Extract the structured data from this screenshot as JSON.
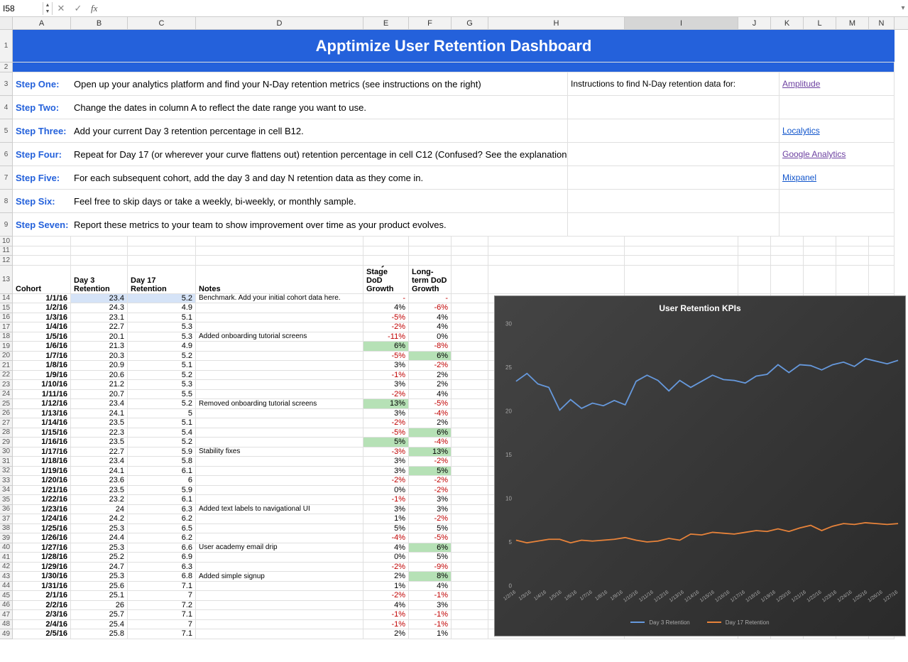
{
  "namebox": "I58",
  "banner": "Apptimize User Retention Dashboard",
  "steps": [
    {
      "label": "Step One:",
      "text": "Open up your analytics platform and find your N-Day retention metrics (see instructions on the right)"
    },
    {
      "label": "Step Two:",
      "text": "Change the dates in column A to reflect the date range you want to use."
    },
    {
      "label": "Step Three:",
      "text": "Add your current Day 3 retention percentage in cell B12."
    },
    {
      "label": "Step Four:",
      "text": "Repeat for Day 17 (or wherever your curve flattens out) retention percentage in cell C12 (Confused? See the explanation here)"
    },
    {
      "label": "Step Five:",
      "text": "For each subsequent cohort, add the day 3 and day N retention data as they come in."
    },
    {
      "label": "Step Six:",
      "text": "Feel free to skip days or take a weekly, bi-weekly, or monthly sample."
    },
    {
      "label": "Step Seven:",
      "text": "Report these metrics to your team to show improvement over time as your product evolves."
    }
  ],
  "side_label": "Instructions to find N-Day retention data for:",
  "side_links": [
    "Amplitude",
    "Localytics",
    "Google Analytics",
    "Mixpanel"
  ],
  "side_link_visited": [
    true,
    false,
    true,
    false
  ],
  "headers": {
    "cohort": "Cohort",
    "d3": "Day 3 Retention",
    "d17": "Day 17 Retention",
    "notes": "Notes",
    "early": "Early Stage DoD Growth",
    "long": "Long-term DoD Growth"
  },
  "rows": [
    {
      "date": "1/1/16",
      "d3": "23.4",
      "d17": "5.2",
      "note": "Benchmark. Add your initial cohort data here.",
      "early": "-",
      "long": "-"
    },
    {
      "date": "1/2/16",
      "d3": "24.3",
      "d17": "4.9",
      "note": "",
      "early": "4%",
      "long": "-6%"
    },
    {
      "date": "1/3/16",
      "d3": "23.1",
      "d17": "5.1",
      "note": "",
      "early": "-5%",
      "long": "4%"
    },
    {
      "date": "1/4/16",
      "d3": "22.7",
      "d17": "5.3",
      "note": "",
      "early": "-2%",
      "long": "4%"
    },
    {
      "date": "1/5/16",
      "d3": "20.1",
      "d17": "5.3",
      "note": "Added onboarding tutorial screens",
      "early": "-11%",
      "long": "0%"
    },
    {
      "date": "1/6/16",
      "d3": "21.3",
      "d17": "4.9",
      "note": "",
      "early": "6%",
      "long": "-8%",
      "ehl": true
    },
    {
      "date": "1/7/16",
      "d3": "20.3",
      "d17": "5.2",
      "note": "",
      "early": "-5%",
      "long": "6%",
      "lhl": true
    },
    {
      "date": "1/8/16",
      "d3": "20.9",
      "d17": "5.1",
      "note": "",
      "early": "3%",
      "long": "-2%"
    },
    {
      "date": "1/9/16",
      "d3": "20.6",
      "d17": "5.2",
      "note": "",
      "early": "-1%",
      "long": "2%"
    },
    {
      "date": "1/10/16",
      "d3": "21.2",
      "d17": "5.3",
      "note": "",
      "early": "3%",
      "long": "2%"
    },
    {
      "date": "1/11/16",
      "d3": "20.7",
      "d17": "5.5",
      "note": "",
      "early": "-2%",
      "long": "4%"
    },
    {
      "date": "1/12/16",
      "d3": "23.4",
      "d17": "5.2",
      "note": "Removed onboarding tutorial screens",
      "early": "13%",
      "long": "-5%",
      "ehl": true
    },
    {
      "date": "1/13/16",
      "d3": "24.1",
      "d17": "5",
      "note": "",
      "early": "3%",
      "long": "-4%"
    },
    {
      "date": "1/14/16",
      "d3": "23.5",
      "d17": "5.1",
      "note": "",
      "early": "-2%",
      "long": "2%"
    },
    {
      "date": "1/15/16",
      "d3": "22.3",
      "d17": "5.4",
      "note": "",
      "early": "-5%",
      "long": "6%",
      "lhl": true
    },
    {
      "date": "1/16/16",
      "d3": "23.5",
      "d17": "5.2",
      "note": "",
      "early": "5%",
      "long": "-4%",
      "ehl": true
    },
    {
      "date": "1/17/16",
      "d3": "22.7",
      "d17": "5.9",
      "note": "Stability fixes",
      "early": "-3%",
      "long": "13%",
      "lhl": true
    },
    {
      "date": "1/18/16",
      "d3": "23.4",
      "d17": "5.8",
      "note": "",
      "early": "3%",
      "long": "-2%"
    },
    {
      "date": "1/19/16",
      "d3": "24.1",
      "d17": "6.1",
      "note": "",
      "early": "3%",
      "long": "5%",
      "lhl": true
    },
    {
      "date": "1/20/16",
      "d3": "23.6",
      "d17": "6",
      "note": "",
      "early": "-2%",
      "long": "-2%"
    },
    {
      "date": "1/21/16",
      "d3": "23.5",
      "d17": "5.9",
      "note": "",
      "early": "0%",
      "long": "-2%"
    },
    {
      "date": "1/22/16",
      "d3": "23.2",
      "d17": "6.1",
      "note": "",
      "early": "-1%",
      "long": "3%"
    },
    {
      "date": "1/23/16",
      "d3": "24",
      "d17": "6.3",
      "note": "Added text labels to navigational UI",
      "early": "3%",
      "long": "3%"
    },
    {
      "date": "1/24/16",
      "d3": "24.2",
      "d17": "6.2",
      "note": "",
      "early": "1%",
      "long": "-2%"
    },
    {
      "date": "1/25/16",
      "d3": "25.3",
      "d17": "6.5",
      "note": "",
      "early": "5%",
      "long": "5%"
    },
    {
      "date": "1/26/16",
      "d3": "24.4",
      "d17": "6.2",
      "note": "",
      "early": "-4%",
      "long": "-5%"
    },
    {
      "date": "1/27/16",
      "d3": "25.3",
      "d17": "6.6",
      "note": "User academy email drip",
      "early": "4%",
      "long": "6%",
      "lhl": true
    },
    {
      "date": "1/28/16",
      "d3": "25.2",
      "d17": "6.9",
      "note": "",
      "early": "0%",
      "long": "5%"
    },
    {
      "date": "1/29/16",
      "d3": "24.7",
      "d17": "6.3",
      "note": "",
      "early": "-2%",
      "long": "-9%"
    },
    {
      "date": "1/30/16",
      "d3": "25.3",
      "d17": "6.8",
      "note": "Added simple signup",
      "early": "2%",
      "long": "8%",
      "lhl": true
    },
    {
      "date": "1/31/16",
      "d3": "25.6",
      "d17": "7.1",
      "note": "",
      "early": "1%",
      "long": "4%"
    },
    {
      "date": "2/1/16",
      "d3": "25.1",
      "d17": "7",
      "note": "",
      "early": "-2%",
      "long": "-1%"
    },
    {
      "date": "2/2/16",
      "d3": "26",
      "d17": "7.2",
      "note": "",
      "early": "4%",
      "long": "3%"
    },
    {
      "date": "2/3/16",
      "d3": "25.7",
      "d17": "7.1",
      "note": "",
      "early": "-1%",
      "long": "-1%"
    },
    {
      "date": "2/4/16",
      "d3": "25.4",
      "d17": "7",
      "note": "",
      "early": "-1%",
      "long": "-1%"
    },
    {
      "date": "2/5/16",
      "d3": "25.8",
      "d17": "7.1",
      "note": "",
      "early": "2%",
      "long": "1%"
    }
  ],
  "columns": [
    "A",
    "B",
    "C",
    "D",
    "E",
    "F",
    "G",
    "H",
    "I",
    "J",
    "K",
    "L",
    "M",
    "N"
  ],
  "chart_data": {
    "type": "line",
    "title": "User Retention KPIs",
    "ylim": [
      0,
      30
    ],
    "yticks": [
      0,
      5,
      10,
      15,
      20,
      25,
      30
    ],
    "x": [
      "1/2/16",
      "1/3/16",
      "1/4/16",
      "1/5/16",
      "1/6/16",
      "1/7/16",
      "1/8/16",
      "1/9/16",
      "1/10/16",
      "1/11/16",
      "1/12/16",
      "1/13/16",
      "1/14/16",
      "1/15/16",
      "1/16/16",
      "1/17/16",
      "1/18/16",
      "1/19/16",
      "1/20/16",
      "1/21/16",
      "1/22/16",
      "1/23/16",
      "1/24/16",
      "1/25/16",
      "1/26/16",
      "1/27/16"
    ],
    "series": [
      {
        "name": "Day 3 Retention",
        "color": "#6699dd",
        "values": [
          23.4,
          24.3,
          23.1,
          22.7,
          20.1,
          21.3,
          20.3,
          20.9,
          20.6,
          21.2,
          20.7,
          23.4,
          24.1,
          23.5,
          22.3,
          23.5,
          22.7,
          23.4,
          24.1,
          23.6,
          23.5,
          23.2,
          24,
          24.2,
          25.3,
          24.4,
          25.3,
          25.2,
          24.7,
          25.3,
          25.6,
          25.1,
          26,
          25.7,
          25.4,
          25.8
        ]
      },
      {
        "name": "Day 17 Retention",
        "color": "#e8833a",
        "values": [
          5.2,
          4.9,
          5.1,
          5.3,
          5.3,
          4.9,
          5.2,
          5.1,
          5.2,
          5.3,
          5.5,
          5.2,
          5,
          5.1,
          5.4,
          5.2,
          5.9,
          5.8,
          6.1,
          6,
          5.9,
          6.1,
          6.3,
          6.2,
          6.5,
          6.2,
          6.6,
          6.9,
          6.3,
          6.8,
          7.1,
          7,
          7.2,
          7.1,
          7,
          7.1
        ]
      }
    ]
  }
}
